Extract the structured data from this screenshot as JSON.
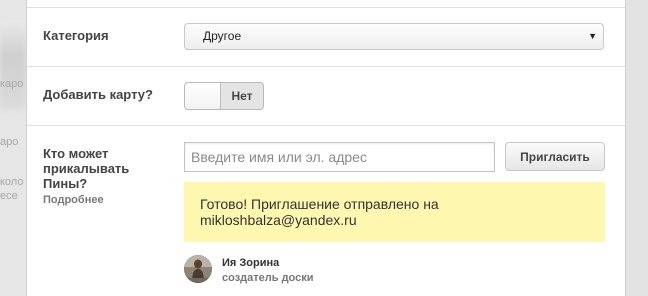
{
  "background": {
    "fragments": [
      "карo",
      "аро",
      "коло",
      "есе"
    ]
  },
  "form": {
    "category": {
      "label": "Категория",
      "selected": "Другое"
    },
    "add_map": {
      "label": "Добавить карту?",
      "toggle_value": "Нет",
      "enabled": false
    },
    "collaborators": {
      "label_line1": "Кто может",
      "label_line2": "прикалывать",
      "label_line3": "Пины?",
      "more_link": "Подробнее",
      "input_placeholder": "Введите имя или эл. адрес",
      "invite_button": "Пригласить",
      "notice_line1": "Готово! Приглашение отправлено на",
      "notice_line2": "mikloshbalza@yandex.ru",
      "member": {
        "name": "Ия Зорина",
        "role": "создатель доски"
      }
    }
  },
  "colors": {
    "notice_bg": "#fdf7b0",
    "panel_bg": "#ffffff",
    "divider": "#e1e1e1"
  }
}
